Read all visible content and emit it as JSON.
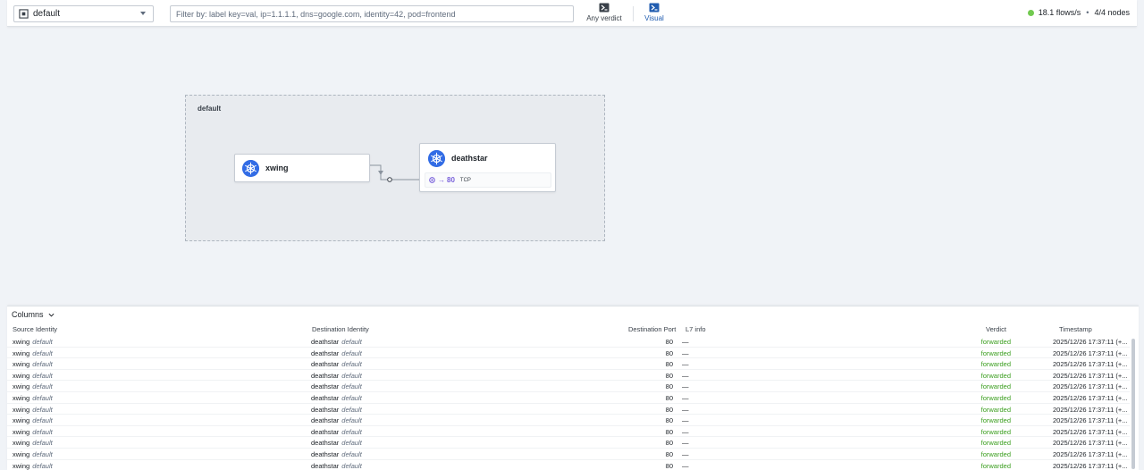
{
  "header": {
    "namespace": "default",
    "filter_placeholder": "Filter by: label key=val, ip=1.1.1.1, dns=google.com, identity=42, pod=frontend",
    "verdict_label": "Any verdict",
    "visual_label": "Visual",
    "flows_rate": "18.1 flows/s",
    "separator": "•",
    "nodes": "4/4 nodes"
  },
  "graph": {
    "namespace_label": "default",
    "source_service": "xwing",
    "dest_service": "deathstar",
    "port_arrow": "→",
    "port": "80",
    "protocol": "TCP"
  },
  "table": {
    "columns_label": "Columns",
    "headers": {
      "source": "Source Identity",
      "destination": "Destination Identity",
      "port": "Destination Port",
      "l7": "L7 info",
      "verdict": "Verdict",
      "timestamp": "Timestamp"
    },
    "rows": [
      {
        "src": "xwing",
        "src_ns": "default",
        "dst": "deathstar",
        "dst_ns": "default",
        "port": "80",
        "l7": "—",
        "verdict": "forwarded",
        "ts": "2025/12/26 17:37:11 (+..."
      },
      {
        "src": "xwing",
        "src_ns": "default",
        "dst": "deathstar",
        "dst_ns": "default",
        "port": "80",
        "l7": "—",
        "verdict": "forwarded",
        "ts": "2025/12/26 17:37:11 (+..."
      },
      {
        "src": "xwing",
        "src_ns": "default",
        "dst": "deathstar",
        "dst_ns": "default",
        "port": "80",
        "l7": "—",
        "verdict": "forwarded",
        "ts": "2025/12/26 17:37:11 (+..."
      },
      {
        "src": "xwing",
        "src_ns": "default",
        "dst": "deathstar",
        "dst_ns": "default",
        "port": "80",
        "l7": "—",
        "verdict": "forwarded",
        "ts": "2025/12/26 17:37:11 (+..."
      },
      {
        "src": "xwing",
        "src_ns": "default",
        "dst": "deathstar",
        "dst_ns": "default",
        "port": "80",
        "l7": "—",
        "verdict": "forwarded",
        "ts": "2025/12/26 17:37:11 (+..."
      },
      {
        "src": "xwing",
        "src_ns": "default",
        "dst": "deathstar",
        "dst_ns": "default",
        "port": "80",
        "l7": "—",
        "verdict": "forwarded",
        "ts": "2025/12/26 17:37:11 (+..."
      },
      {
        "src": "xwing",
        "src_ns": "default",
        "dst": "deathstar",
        "dst_ns": "default",
        "port": "80",
        "l7": "—",
        "verdict": "forwarded",
        "ts": "2025/12/26 17:37:11 (+..."
      },
      {
        "src": "xwing",
        "src_ns": "default",
        "dst": "deathstar",
        "dst_ns": "default",
        "port": "80",
        "l7": "—",
        "verdict": "forwarded",
        "ts": "2025/12/26 17:37:11 (+..."
      },
      {
        "src": "xwing",
        "src_ns": "default",
        "dst": "deathstar",
        "dst_ns": "default",
        "port": "80",
        "l7": "—",
        "verdict": "forwarded",
        "ts": "2025/12/26 17:37:11 (+..."
      },
      {
        "src": "xwing",
        "src_ns": "default",
        "dst": "deathstar",
        "dst_ns": "default",
        "port": "80",
        "l7": "—",
        "verdict": "forwarded",
        "ts": "2025/12/26 17:37:11 (+..."
      },
      {
        "src": "xwing",
        "src_ns": "default",
        "dst": "deathstar",
        "dst_ns": "default",
        "port": "80",
        "l7": "—",
        "verdict": "forwarded",
        "ts": "2025/12/26 17:37:11 (+..."
      },
      {
        "src": "xwing",
        "src_ns": "default",
        "dst": "deathstar",
        "dst_ns": "default",
        "port": "80",
        "l7": "—",
        "verdict": "forwarded",
        "ts": "2025/12/26 17:37:11 (+..."
      }
    ]
  },
  "colors": {
    "accent": "#215db0",
    "status_ok": "#72ca50",
    "verdict_forwarded": "#3a9e1e",
    "kubernetes": "#326ce5",
    "port": "#7961db"
  },
  "icons": {
    "namespace": "namespace-icon",
    "verdict": "verdict-filter-icon",
    "visual": "visual-filter-icon",
    "service": "kubernetes-icon",
    "columns": "chevron-down-icon"
  }
}
